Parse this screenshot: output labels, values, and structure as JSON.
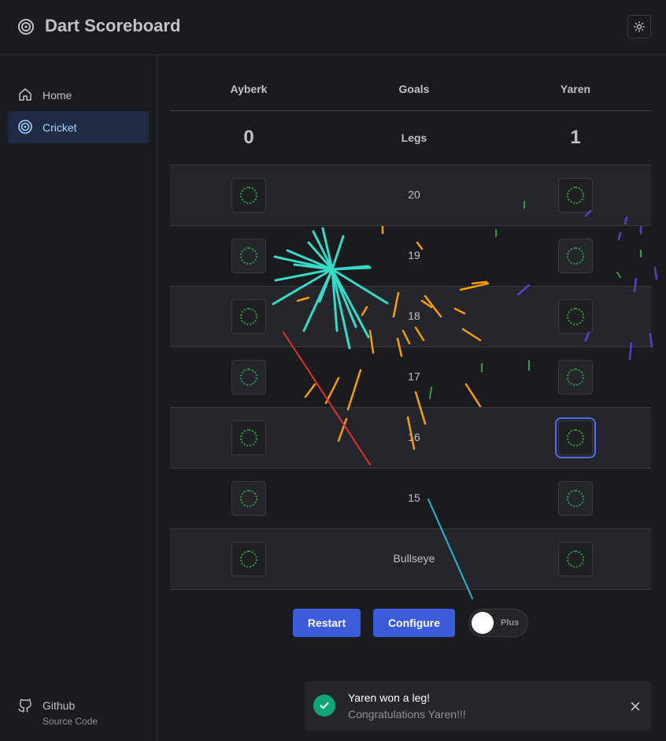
{
  "app": {
    "title": "Dart Scoreboard"
  },
  "sidebar": {
    "items": [
      {
        "label": "Home",
        "icon": "home-icon"
      },
      {
        "label": "Cricket",
        "icon": "target-icon",
        "active": true
      }
    ],
    "github": {
      "label": "Github",
      "sublabel": "Source Code"
    }
  },
  "board": {
    "headers": {
      "player1": "Ayberk",
      "middle": "Goals",
      "player2": "Yaren"
    },
    "legs": {
      "label": "Legs",
      "player1": "0",
      "player2": "1"
    },
    "targets": [
      "20",
      "19",
      "18",
      "17",
      "16",
      "15",
      "Bullseye"
    ]
  },
  "controls": {
    "restart_label": "Restart",
    "configure_label": "Configure",
    "toggle_label": "Plus"
  },
  "notification": {
    "title": "Yaren won a leg!",
    "message": "Congratulations Yaren!!!"
  },
  "colors": {
    "accent": "#3b5bdb",
    "success": "#0ca678",
    "active_nav_bg": "#1f2a44",
    "active_nav_text": "#a5d8ff",
    "mark_dots": "#2f9e44"
  }
}
